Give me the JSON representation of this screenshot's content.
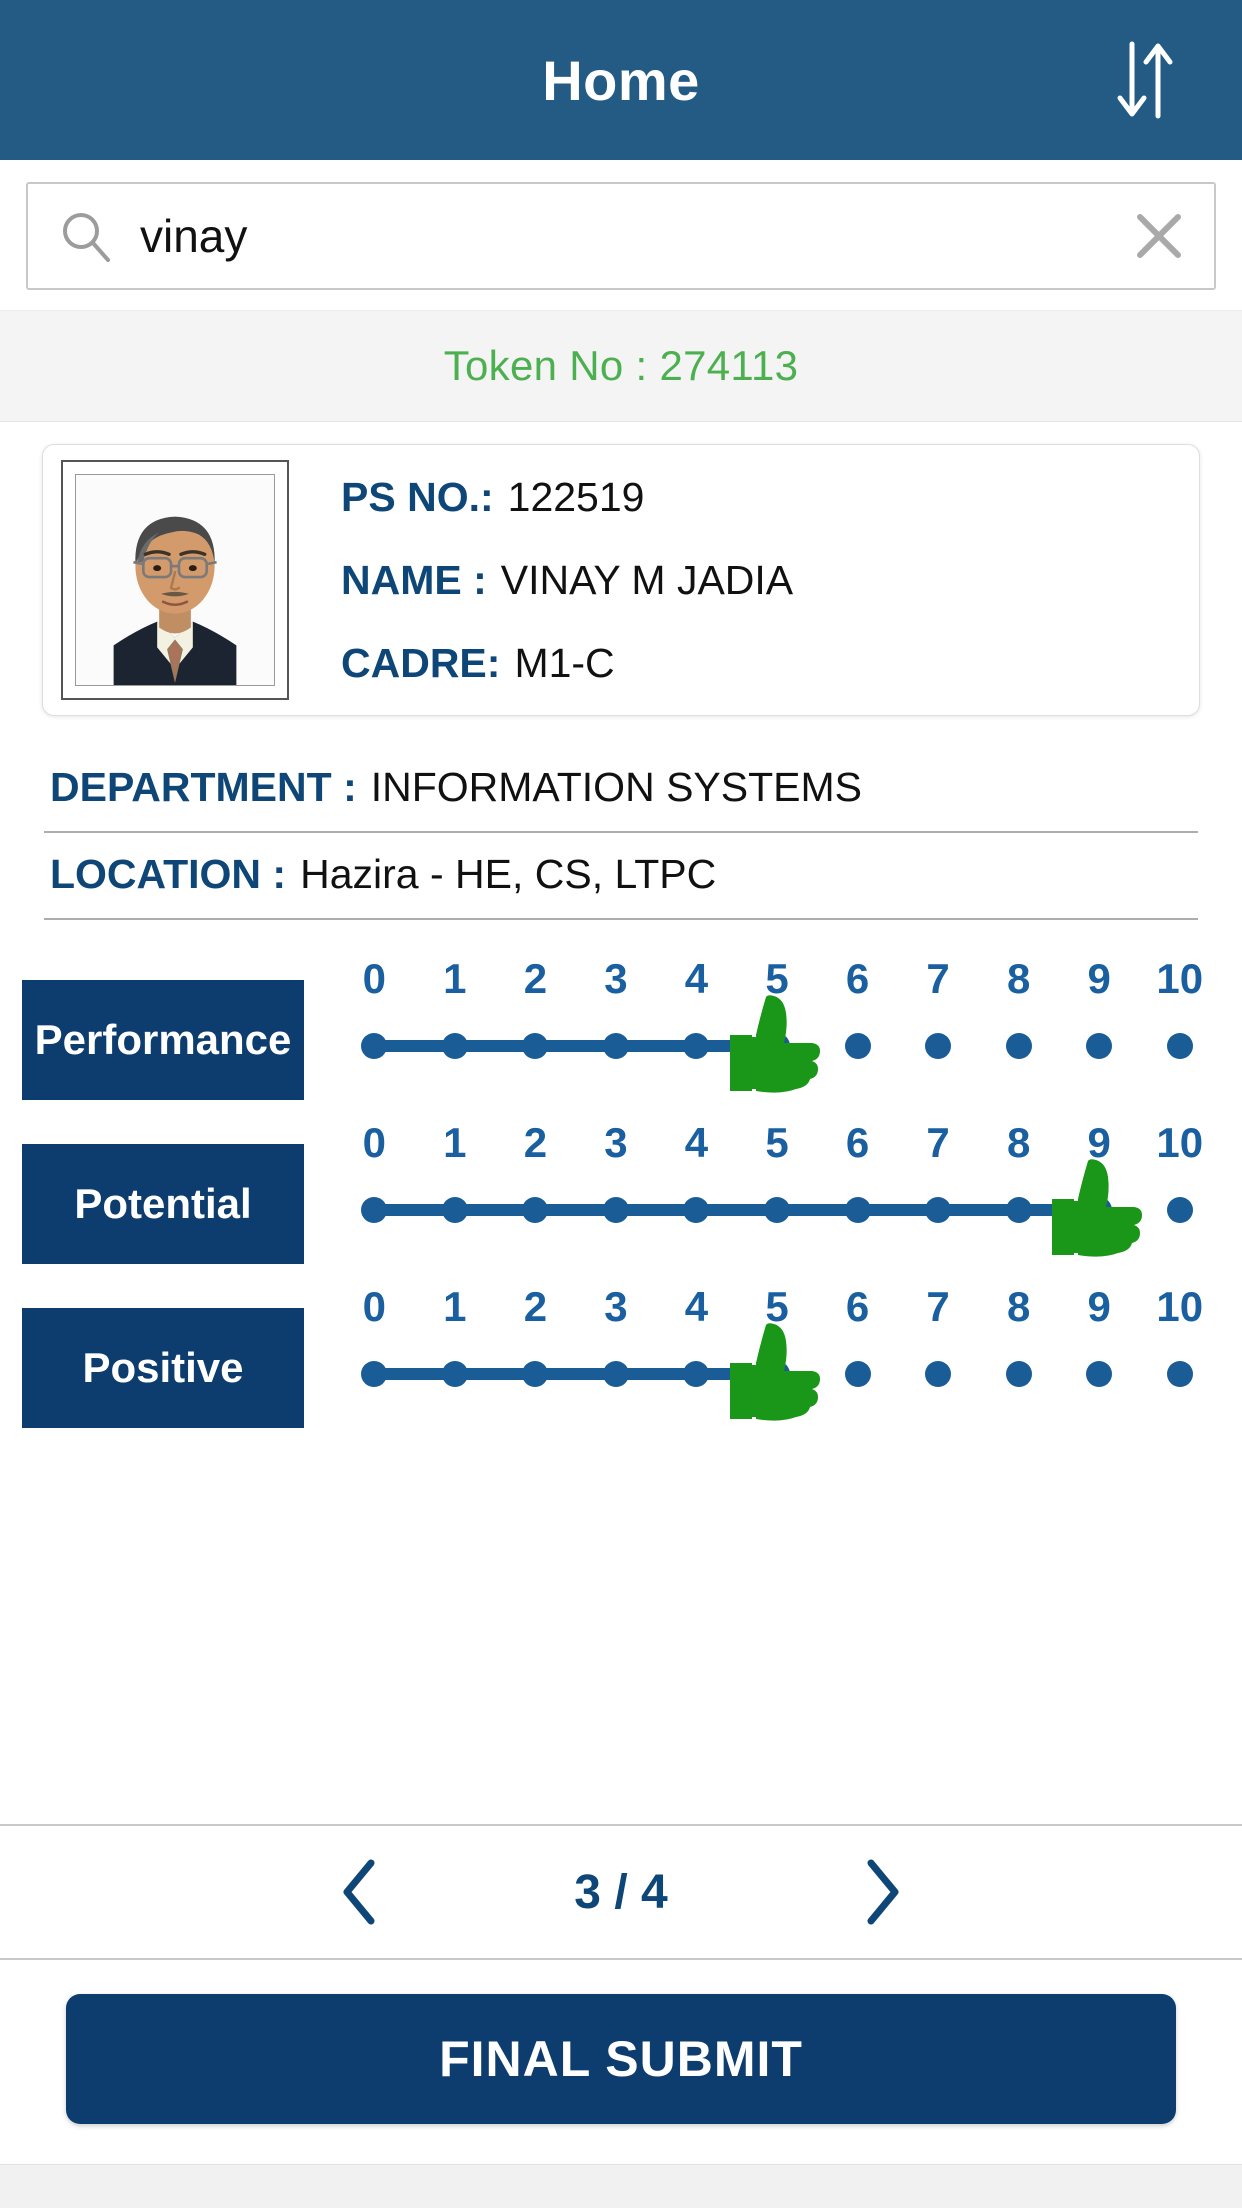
{
  "header": {
    "title": "Home",
    "sort_icon": "sort-updown-icon",
    "bg_color": "#235b85"
  },
  "search": {
    "value": "vinay",
    "placeholder": "Search",
    "search_icon": "search-icon",
    "clear_icon": "close-icon"
  },
  "token": {
    "text": "Token No : 274113",
    "color": "#4cb050"
  },
  "profile": {
    "photo_alt": "employee-photo",
    "fields": [
      {
        "label": "PS NO.:",
        "value": "122519"
      },
      {
        "label": "NAME :",
        "value": "VINAY M JADIA"
      },
      {
        "label": "CADRE:",
        "value": "M1-C"
      }
    ]
  },
  "info": [
    {
      "label": "DEPARTMENT :",
      "value": "INFORMATION SYSTEMS"
    },
    {
      "label": "LOCATION :",
      "value": "Hazira - HE, CS, LTPC"
    }
  ],
  "ratings": {
    "scale": [
      "0",
      "1",
      "2",
      "3",
      "4",
      "5",
      "6",
      "7",
      "8",
      "9",
      "10"
    ],
    "max": 10,
    "track_color": "#1a5c96",
    "thumb_color": "#1a9618",
    "label_bg": "#0d3d6e",
    "items": [
      {
        "label": "Performance",
        "value": 5
      },
      {
        "label": "Potential",
        "value": 9
      },
      {
        "label": "Positive",
        "value": 5
      }
    ]
  },
  "pagination": {
    "prev_icon": "chevron-left-icon",
    "next_icon": "chevron-right-icon",
    "current": 3,
    "total": 4,
    "label": "3 / 4"
  },
  "submit": {
    "label": "FINAL SUBMIT",
    "color": "#0d3d6e"
  }
}
